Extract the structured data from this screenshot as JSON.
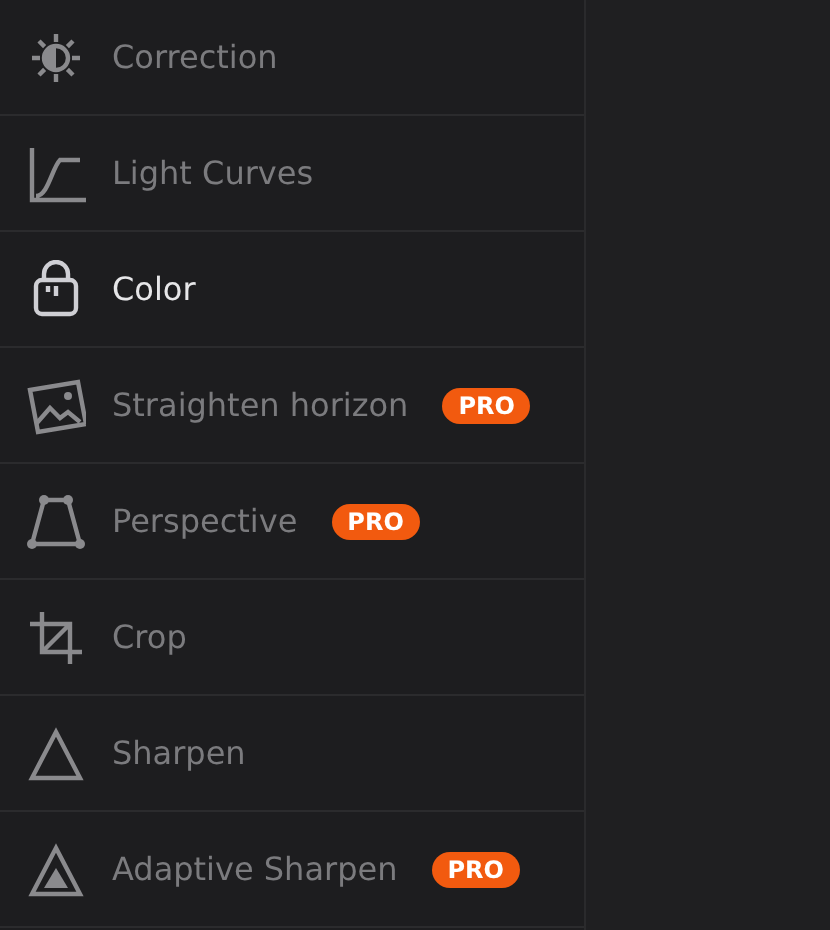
{
  "menu": [
    {
      "label": "Correction",
      "selected": false
    },
    {
      "label": "Light Curves",
      "selected": false
    },
    {
      "label": "Color",
      "selected": true
    },
    {
      "label": "Straighten horizon",
      "selected": false,
      "badge": "PRO"
    },
    {
      "label": "Perspective",
      "selected": false,
      "badge": "PRO"
    },
    {
      "label": "Crop",
      "selected": false
    },
    {
      "label": "Sharpen",
      "selected": false
    },
    {
      "label": "Adaptive Sharpen",
      "selected": false,
      "badge": "PRO"
    }
  ]
}
